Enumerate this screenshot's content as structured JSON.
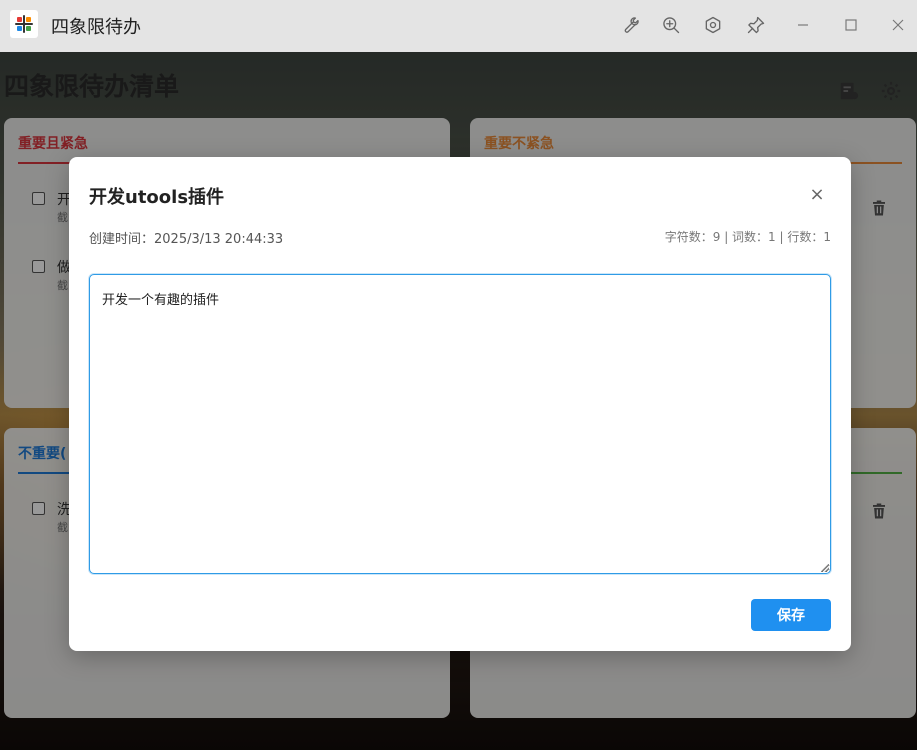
{
  "window": {
    "title": "四象限待办",
    "toolbar_icons": [
      "wrench-icon",
      "zoom-in-icon",
      "hexagon-settings-icon",
      "pin-icon",
      "minimize-icon",
      "maximize-icon",
      "close-icon"
    ]
  },
  "page": {
    "title": "四象限待办清单",
    "header_icons": [
      "stats-icon",
      "gear-icon"
    ]
  },
  "quadrants": [
    {
      "title": "重要且紧急",
      "color": "#d9363e",
      "tasks": [
        {
          "name": "开",
          "sub": "截"
        },
        {
          "name": "做",
          "sub": "截"
        }
      ]
    },
    {
      "title": "重要不紧急",
      "color": "#e8893a",
      "tasks": []
    },
    {
      "title": "不重要(",
      "color": "#1f7ad8",
      "tasks": [
        {
          "name": "洗",
          "sub": "截"
        }
      ]
    },
    {
      "title": "",
      "color": "#52b043",
      "tasks": []
    }
  ],
  "modal": {
    "title": "开发utools插件",
    "created_label": "创建时间：2025/3/13 20:44:33",
    "stats": "字符数：9 | 词数：1 | 行数：1",
    "content": "开发一个有趣的插件",
    "save_label": "保存",
    "close_symbol": "×"
  }
}
